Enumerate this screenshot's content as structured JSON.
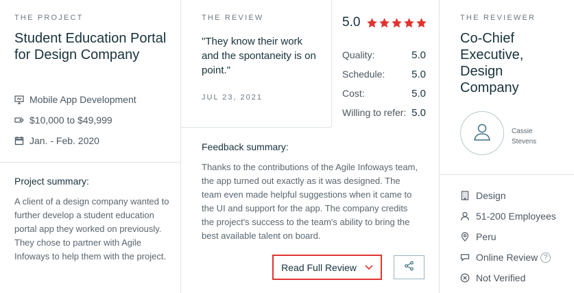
{
  "project": {
    "eyebrow": "THE PROJECT",
    "title": "Student Education Portal for Design Company",
    "service": "Mobile App Development",
    "budget": "$10,000 to $49,999",
    "dates": "Jan. - Feb. 2020",
    "summary_label": "Project summary:",
    "summary": "A client of a design company wanted to further develop a student education portal app they worked on previously. They chose to partner with Agile Infoways to help them with the project."
  },
  "review": {
    "eyebrow": "THE REVIEW",
    "quote": "\"They know their work and the spontaneity is on point.\"",
    "date": "JUL 23, 2021",
    "overall": "5.0",
    "stars": 5,
    "scores": [
      {
        "label": "Quality:",
        "value": "5.0"
      },
      {
        "label": "Schedule:",
        "value": "5.0"
      },
      {
        "label": "Cost:",
        "value": "5.0"
      },
      {
        "label": "Willing to refer:",
        "value": "5.0"
      }
    ],
    "feedback_label": "Feedback summary:",
    "feedback": "Thanks to the contributions of the Agile Infoways team, the app turned out exactly as it was designed. The team even made helpful suggestions when it came to the UI and support for the app. The company credits the project's success to the team's ability to bring the best available talent on board.",
    "read_label": "Read Full Review"
  },
  "reviewer": {
    "eyebrow": "THE REVIEWER",
    "title": "Co-Chief Executive, Design Company",
    "name": "Cassie Stevens",
    "industry": "Design",
    "employees": "51-200 Employees",
    "location": "Peru",
    "review_type": "Online Review",
    "help": "?",
    "verification": "Not Verified"
  },
  "colors": {
    "star": "#e0332f",
    "accent_border": "#e0332f",
    "divider": "#dfe3e6",
    "heading": "#17313b"
  }
}
